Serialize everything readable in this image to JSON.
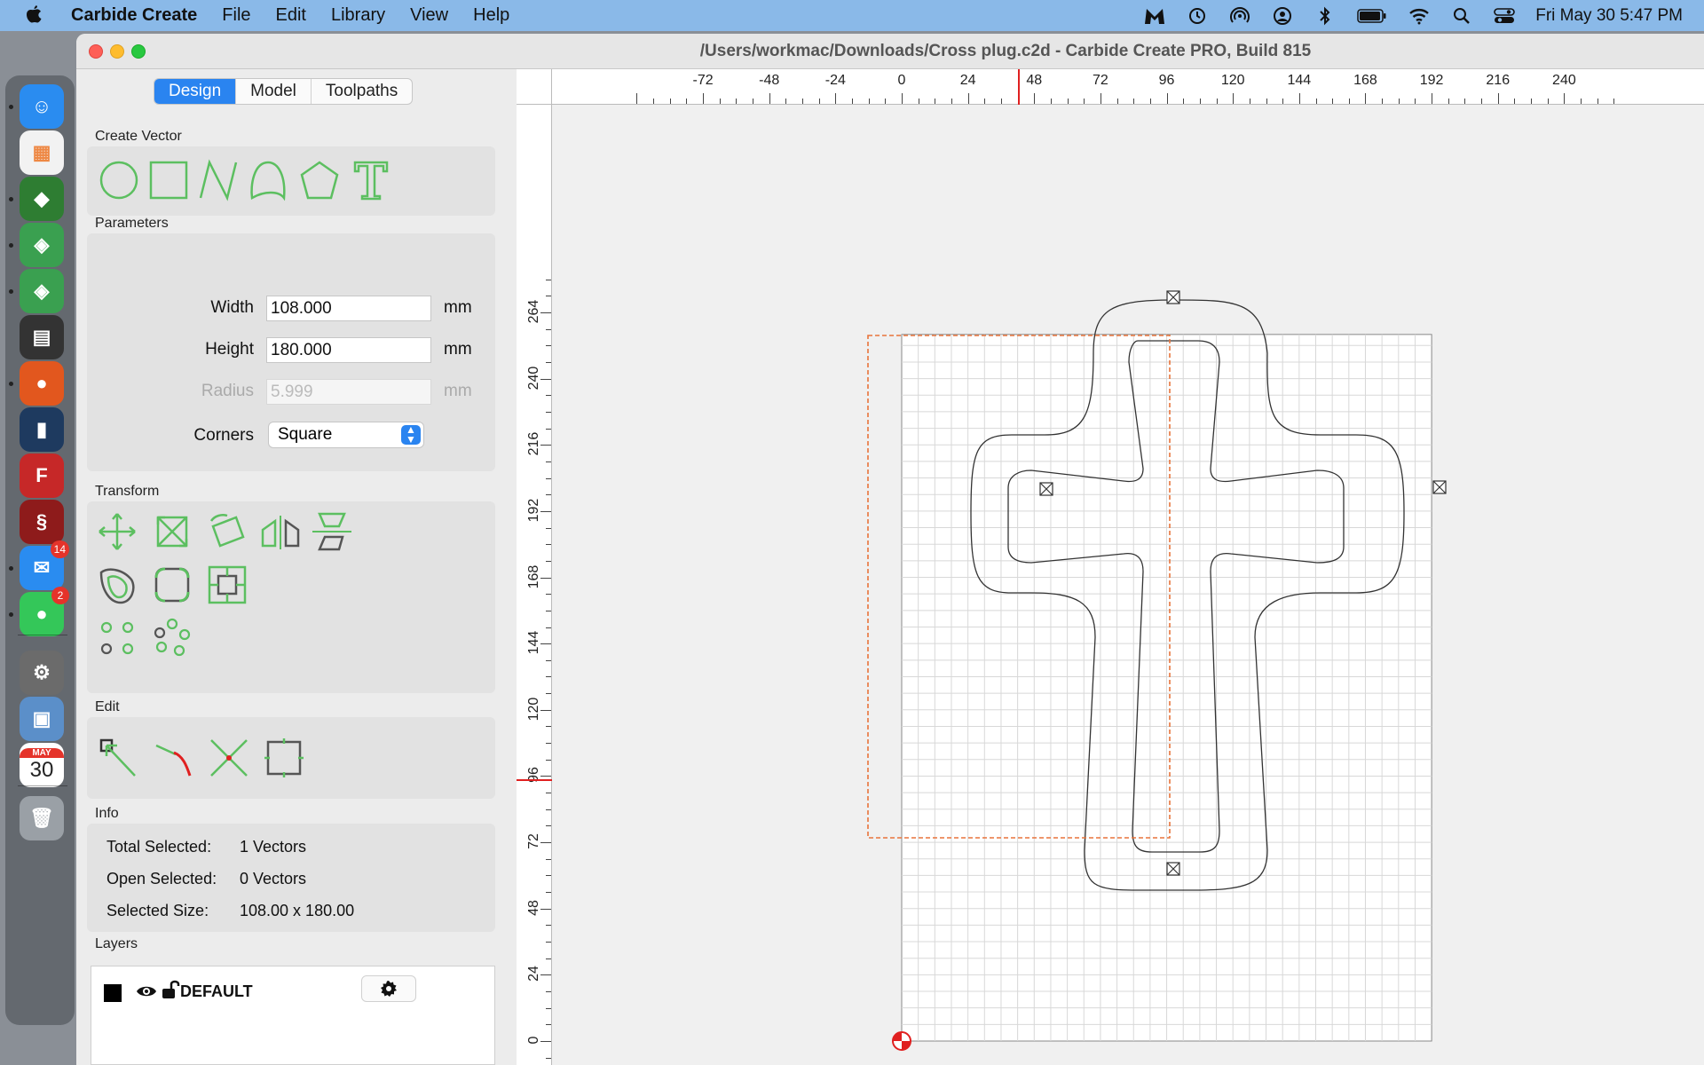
{
  "menubar": {
    "app_name": "Carbide Create",
    "menus": [
      "File",
      "Edit",
      "Library",
      "View",
      "Help"
    ],
    "clock": "Fri May 30  5:47 PM",
    "status_icons": [
      "malwarebytes-icon",
      "time-machine-icon",
      "airdrop-icon",
      "user-icon",
      "bluetooth-icon",
      "battery-icon",
      "wifi-icon",
      "spotlight-icon",
      "control-center-icon"
    ]
  },
  "dock": {
    "items": [
      {
        "name": "finder",
        "color": "#2a8cf0",
        "glyph": "☺"
      },
      {
        "name": "launchpad",
        "color": "#f2f2f2",
        "glyph": "▦"
      },
      {
        "name": "carbide-3d",
        "color": "#2e7d32",
        "glyph": "◆"
      },
      {
        "name": "carbide-create-1",
        "color": "#3aa050",
        "glyph": "◈",
        "badge": ""
      },
      {
        "name": "carbide-create-2",
        "color": "#3aa050",
        "glyph": "◈"
      },
      {
        "name": "calculator",
        "color": "#333333",
        "glyph": "▤"
      },
      {
        "name": "firefox",
        "color": "#e2571e",
        "glyph": "●"
      },
      {
        "name": "app-phone",
        "color": "#1e3a5f",
        "glyph": "▮"
      },
      {
        "name": "fusion",
        "color": "#c62828",
        "glyph": "F"
      },
      {
        "name": "app-dragon",
        "color": "#8e1b1b",
        "glyph": "§"
      },
      {
        "name": "mail",
        "color": "#2a8cf0",
        "glyph": "✉",
        "badge": "14"
      },
      {
        "name": "messages",
        "color": "#34c759",
        "glyph": "●",
        "badge": "2"
      },
      {
        "name": "system-settings",
        "color": "#6b6b6b",
        "glyph": "⚙"
      },
      {
        "name": "preview",
        "color": "#5b8fc9",
        "glyph": "▣"
      },
      {
        "name": "calendar",
        "color": "#ffffff",
        "glyph": "30",
        "month": "MAY"
      },
      {
        "name": "trash",
        "color": "#9aa0a6",
        "glyph": "🗑"
      }
    ]
  },
  "window": {
    "title": "/Users/workmac/Downloads/Cross plug.c2d - Carbide Create PRO, Build 815"
  },
  "tabs": [
    "Design",
    "Model",
    "Toolpaths"
  ],
  "sections": {
    "create_vector": "Create Vector",
    "parameters": "Parameters",
    "transform": "Transform",
    "edit": "Edit",
    "info": "Info",
    "layers": "Layers"
  },
  "parameters": {
    "width_label": "Width",
    "width_value": "108.000",
    "width_unit": "mm",
    "height_label": "Height",
    "height_value": "180.000",
    "height_unit": "mm",
    "radius_label": "Radius",
    "radius_value": "5.999",
    "radius_unit": "mm",
    "corners_label": "Corners",
    "corners_value": "Square"
  },
  "info": {
    "total_label": "Total Selected:",
    "total_value": "1 Vectors",
    "open_label": "Open Selected:",
    "open_value": "0 Vectors",
    "size_label": "Selected Size:",
    "size_value": "108.00 x 180.00"
  },
  "layers": [
    {
      "name": "DEFAULT",
      "color": "#000000",
      "visible": true,
      "locked": false
    }
  ],
  "rulers": {
    "top": [
      "-72",
      "-48",
      "-24",
      "0",
      "24",
      "48",
      "72",
      "96",
      "120",
      "144",
      "168",
      "192",
      "216",
      "240"
    ],
    "left": [
      "264",
      "240",
      "216",
      "192",
      "168",
      "144",
      "120",
      "96",
      "72",
      "48",
      "24",
      "0"
    ]
  },
  "colors": {
    "accent": "#2a84f0",
    "tool_green": "#5cbf60",
    "selection": "#e8743b",
    "cursor_marker": "#e02020"
  }
}
